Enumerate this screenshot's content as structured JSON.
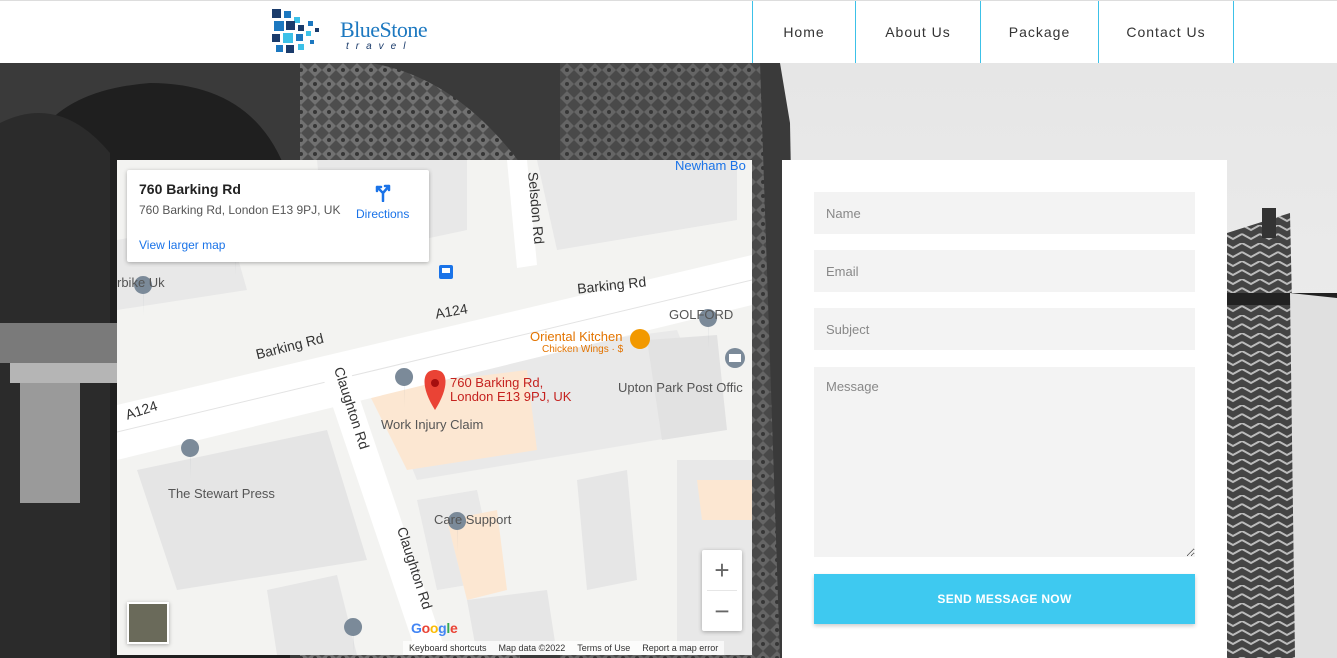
{
  "brand": {
    "name": "BlueStone",
    "tagline": "travel"
  },
  "nav": {
    "items": [
      {
        "label": "Home",
        "name": "nav-home"
      },
      {
        "label": "About Us",
        "name": "nav-about-us"
      },
      {
        "label": "Package",
        "name": "nav-package"
      },
      {
        "label": "Contact Us",
        "name": "nav-contact-us"
      }
    ]
  },
  "map": {
    "place_title": "760 Barking Rd",
    "place_address": "760 Barking Rd, London E13 9PJ, UK",
    "directions_label": "Directions",
    "larger_map_link": "View larger map",
    "marker_label_line1": "760 Barking Rd,",
    "marker_label_line2": "London E13 9PJ, UK",
    "roads": [
      "Barking Rd",
      "A124",
      "Barking Rd",
      "A124",
      "Claughton Rd",
      "Claughton Rd",
      "Selsdon Rd"
    ],
    "pois": [
      "Work Injury Claim",
      "The Stewart Press",
      "Care Support",
      "GOLFORD",
      "Upton Park Post Offic",
      "Newham Bo",
      "Oriental Kitchen",
      "Chicken Wings · $",
      "rbike Uk"
    ],
    "google": "Google",
    "footer": {
      "shortcuts": "Keyboard shortcuts",
      "data": "Map data ©2022",
      "terms": "Terms of Use",
      "report": "Report a map error"
    },
    "zoom_in": "+",
    "zoom_out": "−"
  },
  "form": {
    "name_placeholder": "Name",
    "email_placeholder": "Email",
    "subject_placeholder": "Subject",
    "message_placeholder": "Message",
    "submit_label": "SEND MESSAGE NOW"
  },
  "colors": {
    "accent": "#3ec9f0",
    "nav_border": "#3cc1e8",
    "marker": "#ea4335",
    "link": "#1a73e8"
  }
}
